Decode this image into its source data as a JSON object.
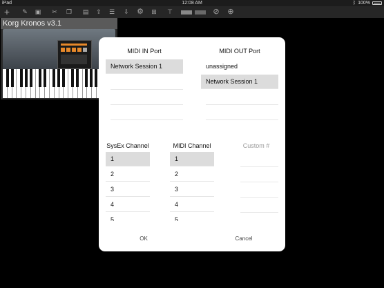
{
  "status_bar": {
    "device": "iPad",
    "time": "12:08 AM",
    "battery": "100%"
  },
  "device_panel": {
    "title": "Korg Kronos v3.1"
  },
  "dialog": {
    "midi_in": {
      "header": "MIDI IN Port",
      "items": [
        "Network Session 1"
      ],
      "selected_index": 0
    },
    "midi_out": {
      "header": "MIDI OUT Port",
      "items": [
        "unassigned",
        "Network Session 1"
      ],
      "selected_index": 1
    },
    "sysex_channel": {
      "header": "SysEx Channel",
      "items": [
        "1",
        "2",
        "3",
        "4",
        "5"
      ],
      "selected_index": 0
    },
    "midi_channel": {
      "header": "MIDI Channel",
      "items": [
        "1",
        "2",
        "3",
        "4",
        "5"
      ],
      "selected_index": 0
    },
    "custom": {
      "header": "Custom #"
    },
    "ok_label": "OK",
    "cancel_label": "Cancel"
  }
}
